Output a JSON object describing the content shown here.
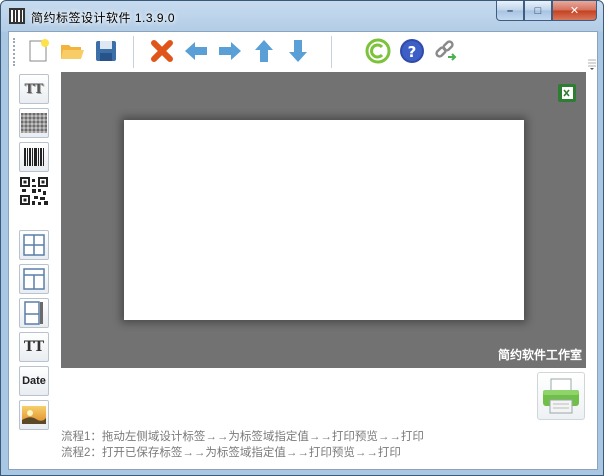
{
  "window": {
    "title": "简约标签设计软件  1.3.9.0",
    "minimize_label": "–",
    "maximize_label": "□",
    "close_label": "✕"
  },
  "toolbar": {
    "items": [
      {
        "name": "new",
        "icon": "new-file-icon"
      },
      {
        "name": "open",
        "icon": "open-folder-icon"
      },
      {
        "name": "save",
        "icon": "floppy-disk-icon"
      },
      {
        "name": "delete",
        "icon": "red-x-icon"
      },
      {
        "name": "move-left",
        "icon": "arrow-left-icon"
      },
      {
        "name": "move-right",
        "icon": "arrow-right-icon"
      },
      {
        "name": "move-up",
        "icon": "arrow-up-icon"
      },
      {
        "name": "move-down",
        "icon": "arrow-down-icon"
      },
      {
        "name": "copyright",
        "icon": "copyright-icon"
      },
      {
        "name": "help",
        "icon": "help-icon"
      },
      {
        "name": "link",
        "icon": "link-icon"
      }
    ]
  },
  "sidebar": {
    "items": [
      {
        "name": "text-tool",
        "icon": "text-tt-icon"
      },
      {
        "name": "image-tool",
        "icon": "gray-texture-icon"
      },
      {
        "name": "barcode-tool",
        "icon": "barcode-icon"
      },
      {
        "name": "qrcode-tool",
        "icon": "qrcode-icon"
      },
      {
        "name": "grid-tool",
        "icon": "grid-layout-icon"
      },
      {
        "name": "table-tool",
        "icon": "table-layout-icon"
      },
      {
        "name": "vertical-line-tool",
        "icon": "vertical-layout-icon"
      },
      {
        "name": "text-field-tool",
        "icon": "text-tt-bold-icon"
      },
      {
        "name": "date-tool",
        "icon": "date-icon"
      },
      {
        "name": "picture-tool",
        "icon": "picture-icon"
      }
    ],
    "date_label": "Date",
    "tt_label": "TT"
  },
  "canvas": {
    "studio_label": "简约软件工作室",
    "excel_icon": "excel-icon"
  },
  "print": {
    "icon": "printer-icon"
  },
  "steps": [
    "流程1：拖动左侧域设计标签→→为标签域指定值→→打印预览→→打印",
    "流程2：打开已保存标签→→为标签域指定值→→打印预览→→打印"
  ],
  "colors": {
    "canvas_bg": "#727272",
    "label_bg": "#ffffff",
    "arrow_blue": "#5a9fd6",
    "delete_red": "#e0561a",
    "step_text": "#7a7a7a"
  }
}
